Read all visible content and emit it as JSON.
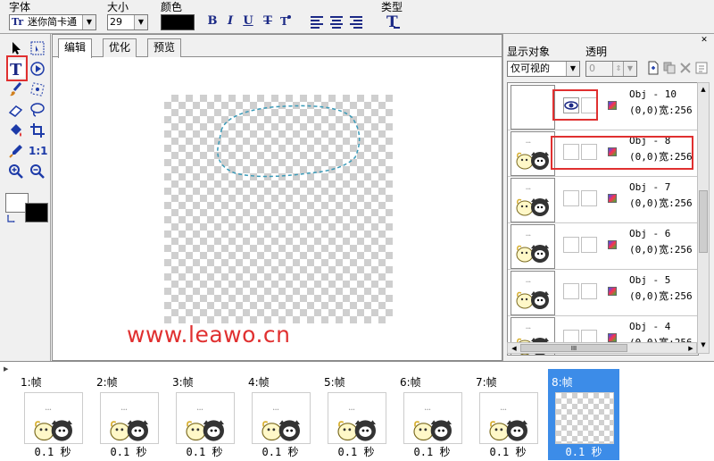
{
  "toolbar": {
    "font_label": "字体",
    "font_value": "迷你简卡通",
    "size_label": "大小",
    "size_value": "29",
    "color_label": "颜色",
    "type_label": "类型",
    "bold": "B",
    "italic": "I",
    "underline": "U",
    "strike": "T",
    "colors": {
      "swatch": "#000000"
    }
  },
  "tabs": [
    {
      "label": "编辑"
    },
    {
      "label": "优化"
    },
    {
      "label": "预览"
    }
  ],
  "right_panel": {
    "display_label": "显示对象",
    "transparency_label": "透明",
    "display_value": "仅可视的",
    "transparency_value": "0",
    "objects": [
      {
        "name": "Obj - 10",
        "pos": "(0,0)宽:256"
      },
      {
        "name": "Obj - 8",
        "pos": "(0,0)宽:256"
      },
      {
        "name": "Obj - 7",
        "pos": "(0,0)宽:256"
      },
      {
        "name": "Obj - 6",
        "pos": "(0,0)宽:256"
      },
      {
        "name": "Obj - 5",
        "pos": "(0,0)宽:256"
      },
      {
        "name": "Obj - 4",
        "pos": "(0,0)宽:256"
      }
    ],
    "hscroll_glyph": "III"
  },
  "watermark": "www.leawo.cn",
  "frames": [
    {
      "label": "1:帧",
      "time": "0.1 秒"
    },
    {
      "label": "2:帧",
      "time": "0.1 秒"
    },
    {
      "label": "3:帧",
      "time": "0.1 秒"
    },
    {
      "label": "4:帧",
      "time": "0.1 秒"
    },
    {
      "label": "5:帧",
      "time": "0.1 秒"
    },
    {
      "label": "6:帧",
      "time": "0.1 秒"
    },
    {
      "label": "7:帧",
      "time": "0.1 秒"
    },
    {
      "label": "8:帧",
      "time": "0.1 秒"
    }
  ],
  "tools": {
    "ratio_label": "1:1"
  },
  "accent": {
    "highlight": "#e03030",
    "selection": "#3c8ce8"
  }
}
